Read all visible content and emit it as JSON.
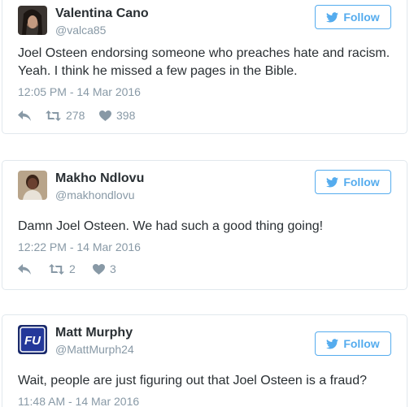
{
  "colors": {
    "accent": "#55acee",
    "muted": "#8899a6",
    "text": "#292f33",
    "border": "#e1e8ed"
  },
  "tweets": [
    {
      "author": {
        "name": "Valentina Cano",
        "handle": "@valca85"
      },
      "follow_label": "Follow",
      "text": "Joel Osteen endorsing someone who preaches hate and racism. Yeah. I think he missed a few pages in the Bible.",
      "timestamp": "12:05 PM - 14 Mar 2016",
      "retweets": "278",
      "likes": "398"
    },
    {
      "author": {
        "name": "Makho Ndlovu",
        "handle": "@makhondlovu"
      },
      "follow_label": "Follow",
      "text": "Damn Joel Osteen. We had such a good thing going!",
      "timestamp": "12:22 PM - 14 Mar 2016",
      "retweets": "2",
      "likes": "3"
    },
    {
      "author": {
        "name": "Matt Murphy",
        "handle": "@MattMurph24",
        "avatar_text": "FU"
      },
      "follow_label": "Follow",
      "text": "Wait, people are just figuring out that Joel Osteen is a fraud?",
      "timestamp": "11:48 AM - 14 Mar 2016"
    }
  ]
}
